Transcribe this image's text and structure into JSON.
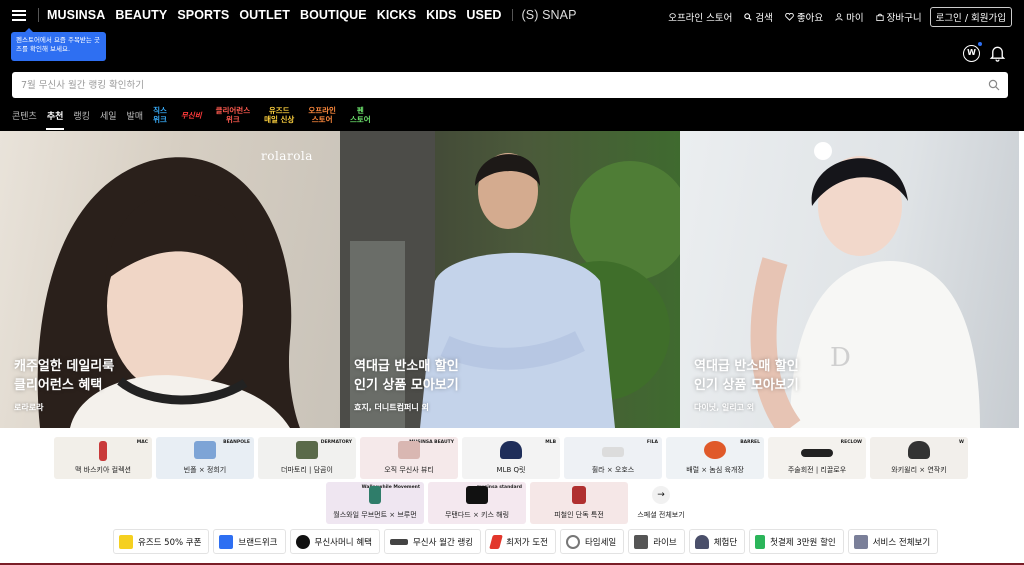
{
  "header": {
    "brands": [
      "MUSINSA",
      "BEAUTY",
      "SPORTS",
      "OUTLET",
      "BOUTIQUE",
      "KICKS",
      "KIDS",
      "USED"
    ],
    "snap": "(S) SNAP",
    "utility": {
      "offline": "오프라인 스토어",
      "search": "검색",
      "like": "좋아요",
      "my": "마이",
      "cart": "장바구니",
      "login": "로그인 / 회원가입"
    },
    "tooltip": "펜스토어에서 요즘 주목받는 굿즈를 확인해 보세요."
  },
  "search": {
    "placeholder": "7월 무신사 월간 랭킹 확인하기"
  },
  "tabs": [
    {
      "label": "콘텐츠",
      "color": "#bbbbbb"
    },
    {
      "label": "추천",
      "color": "#ffffff"
    },
    {
      "label": "랭킹",
      "color": "#bbbbbb"
    },
    {
      "label": "세일",
      "color": "#bbbbbb"
    },
    {
      "label": "발매",
      "color": "#bbbbbb"
    }
  ],
  "special_tabs": [
    {
      "line1": "직스",
      "line2": "위크",
      "color": "#3ab0ff"
    },
    {
      "line1": "무신비",
      "line2": "",
      "color": "#ff3b3b"
    },
    {
      "line1": "클리어런스",
      "line2": "위크",
      "color": "#ff5a4e"
    },
    {
      "line1": "유즈드",
      "line2": "매일 신상",
      "color": "#ffd23f"
    },
    {
      "line1": "오프라인",
      "line2": "스토어",
      "color": "#ff8a3d"
    },
    {
      "line1": "펜",
      "line2": "스토어",
      "color": "#6be06b"
    }
  ],
  "heroes": [
    {
      "title1": "캐주얼한 데일리룩",
      "title2": "클리어런스 혜택",
      "sub": "로라로라",
      "mark": "rolarola"
    },
    {
      "title1": "역대급 반소매 할인",
      "title2": "인기 상품 모아보기",
      "sub": "효지, 더니트컴퍼니 외"
    },
    {
      "title1": "역대급 반소매 할인",
      "title2": "인기 상품 모아보기",
      "sub": "다이닛, 일리고 외"
    }
  ],
  "collabs_row1": [
    {
      "label": "맥 바스키아 컬렉션",
      "logo": "MAC",
      "thumb": "#c93a3a"
    },
    {
      "label": "빈폴 × 정희기",
      "logo": "BEANPOLE",
      "thumb": "#7da4d6"
    },
    {
      "label": "더마토리 | 담곰이",
      "logo": "DERMATORY",
      "thumb": "#5a6a4a"
    },
    {
      "label": "오직 무신사 뷰티",
      "logo": "MUSINSA BEAUTY",
      "thumb": "#d9b7b2"
    },
    {
      "label": "MLB Q릿",
      "logo": "MLB",
      "thumb": "#1f2e5a"
    },
    {
      "label": "휠라 × 오호스",
      "logo": "FILA",
      "thumb": "#e8e8e8"
    },
    {
      "label": "배럴 × 놈심 육개장",
      "logo": "BARREL",
      "thumb": "#e05a2a"
    },
    {
      "label": "주술회전 | 리끌로우",
      "logo": "RECLOW",
      "thumb": "#222222"
    },
    {
      "label": "와키윌리 × 연작키",
      "logo": "W",
      "thumb": "#333333"
    }
  ],
  "collabs_row2": [
    {
      "label": "월스와일 무브먼트 × 브루먼",
      "logo": "Wallsewhile Movement",
      "thumb": "#2f7d6a"
    },
    {
      "label": "무탠다드 × 키스 해링",
      "logo": "musinsa standard",
      "thumb": "#111111"
    },
    {
      "label": "피철인 단독 특전",
      "logo": "",
      "thumb": "#b03030"
    }
  ],
  "more": {
    "label": "스페셜 전체보기",
    "arrow": "→"
  },
  "chips": [
    {
      "label": "유즈드 50% 쿠폰",
      "color": "#f5d020"
    },
    {
      "label": "브랜드위크",
      "color": "#2e6ff2"
    },
    {
      "label": "무신사머니 혜택",
      "color": "#111111"
    },
    {
      "label": "무신사 월간 랭킹",
      "color": "#444444"
    },
    {
      "label": "최저가 도전",
      "color": "#e2362b"
    },
    {
      "label": "타임세일",
      "color": "#777777"
    },
    {
      "label": "라이브",
      "color": "#555555"
    },
    {
      "label": "체험단",
      "color": "#4a4f6a"
    },
    {
      "label": "첫결제 3만원 할인",
      "color": "#2bb55a"
    },
    {
      "label": "서비스 전체보기",
      "color": "#7a7f99"
    }
  ]
}
